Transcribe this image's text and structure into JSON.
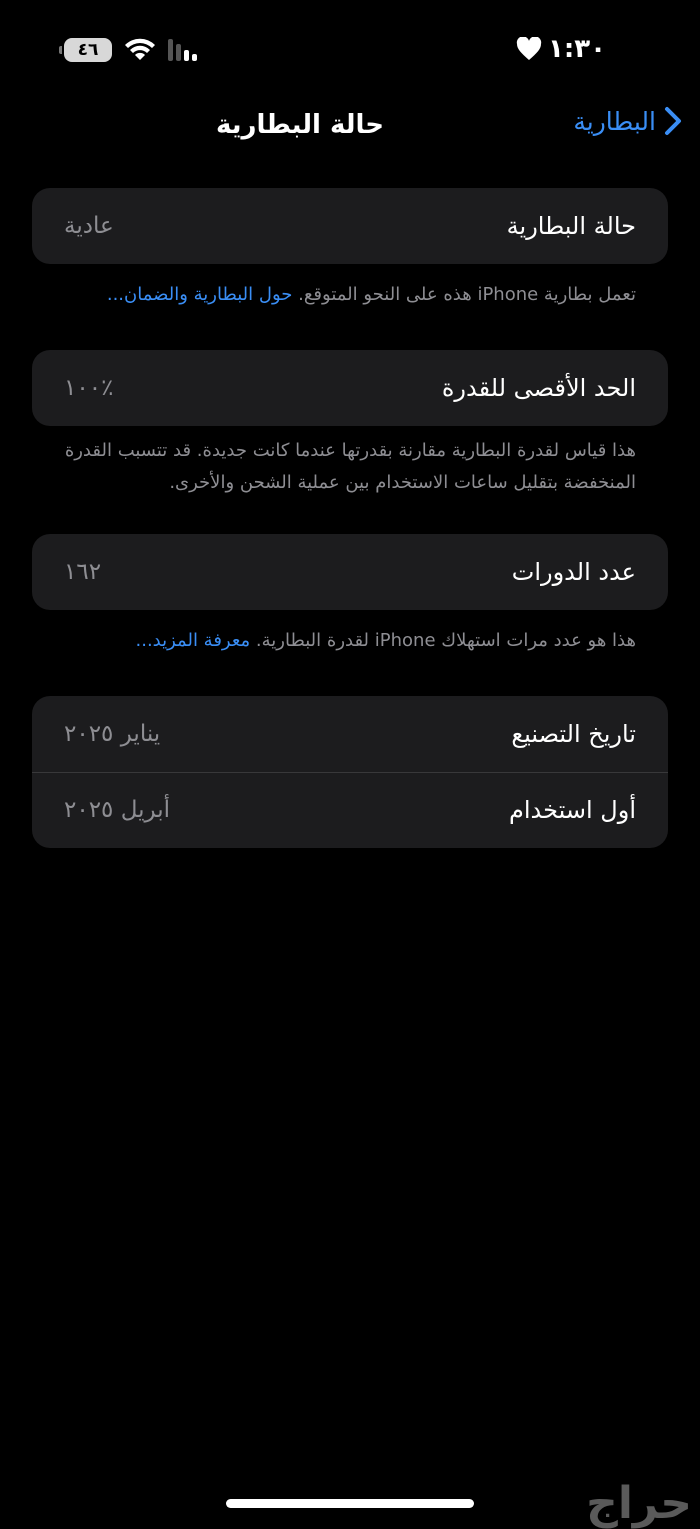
{
  "status_bar": {
    "time": "١:٣٠",
    "battery_level": "٤٦",
    "icons": [
      "heart-icon",
      "wifi-icon",
      "cellular-signal-icon",
      "battery-icon"
    ]
  },
  "nav": {
    "back_label": "البطارية",
    "title": "حالة البطارية"
  },
  "sections": {
    "health": {
      "label": "حالة البطارية",
      "value": "عادية",
      "footnote_text": "تعمل بطارية iPhone هذه على النحو المتوقع.",
      "footnote_link": "حول البطارية والضمان..."
    },
    "capacity": {
      "label": "الحد الأقصى للقدرة",
      "value": "٪١٠٠",
      "footnote_text": "هذا قياس لقدرة البطارية مقارنة بقدرتها عندما كانت جديدة. قد تتسبب القدرة المنخفضة بتقليل ساعات الاستخدام بين عملية الشحن والأخرى."
    },
    "cycles": {
      "label": "عدد الدورات",
      "value": "١٦٢",
      "footnote_text": "هذا هو عدد مرات استهلاك iPhone لقدرة البطارية.",
      "footnote_link": "معرفة المزيد..."
    },
    "dates": {
      "manufacture_label": "تاريخ التصنيع",
      "manufacture_value": "يناير ٢٠٢٥",
      "first_use_label": "أول استخدام",
      "first_use_value": "أبريل ٢٠٢٥"
    }
  },
  "watermark": "حراج",
  "colors": {
    "background": "#000000",
    "group_background": "#1c1c1e",
    "accent": "#3a8ef5",
    "secondary_text": "#8e8e93"
  }
}
